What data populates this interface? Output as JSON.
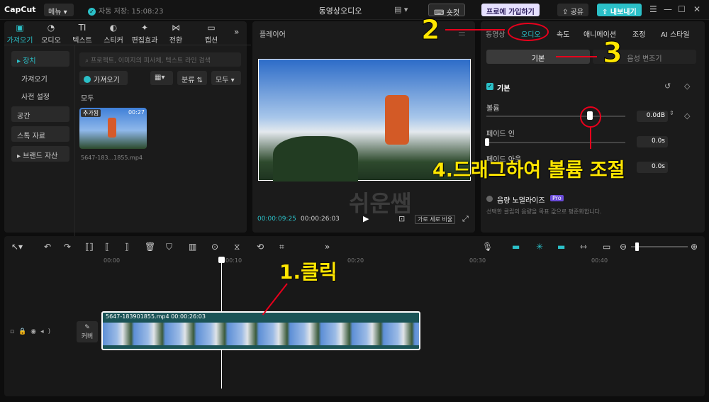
{
  "titlebar": {
    "logo": "CapCut",
    "menu_label": "메뉴 ▾",
    "autosave_text": "자동 저장: 15:08:23",
    "project_title": "동영상오디오",
    "shortcut_label": "숏컷",
    "pro_label": "프로에 가입하기",
    "share_label": "공유",
    "export_label": "내보내기"
  },
  "left_tabs": [
    {
      "icon": "media-icon",
      "label": "가져오기",
      "active": true
    },
    {
      "icon": "audio-icon",
      "label": "오디오"
    },
    {
      "icon": "text-icon",
      "label": "텍스트"
    },
    {
      "icon": "sticker-icon",
      "label": "스티커"
    },
    {
      "icon": "effects-icon",
      "label": "편집효과"
    },
    {
      "icon": "transition-icon",
      "label": "전환"
    },
    {
      "icon": "caption-icon",
      "label": "캡션"
    }
  ],
  "sidebar": [
    "▸ 장치",
    "가져오기",
    "사전 설정",
    "공간",
    "스톡 자료",
    "▸ 브랜드 자산"
  ],
  "media": {
    "search_placeholder": "프로젝트, 이미지의 피사체, 텍스트 라인 검색",
    "import_label": "가져오기",
    "sort_label": "분류 ⇅",
    "all_filter_label": "모두 ▾",
    "section_label": "모두",
    "thumb_badge": "추가됨",
    "thumb_duration": "00:27",
    "thumb_name": "5647-183...1855.mp4"
  },
  "player": {
    "title": "플레이어",
    "current_time": "00:00:09:25",
    "total_time": "00:00:26:03",
    "ratio_label": "가로 세로 비율",
    "watermark": "쉬운쌤"
  },
  "right_panel": {
    "tabs": [
      "동영상",
      "오디오",
      "속도",
      "애니메이션",
      "조정",
      "AI 스타일"
    ],
    "sub_tabs": [
      "기본",
      "음성 변조기"
    ],
    "section_title": "기본",
    "volume_label": "볼륨",
    "volume_value": "0.0dB",
    "fadein_label": "페이드 인",
    "fadein_value": "0.0s",
    "fadeout_label": "페이드 아웃",
    "fadeout_value": "0.0s",
    "normalize_label": "음량 노멀라이즈",
    "pro_badge": "Pro",
    "normalize_desc": "선택한 클립의 음량을 목표 값으로 평준화합니다."
  },
  "timeline": {
    "ruler": [
      "00:00",
      "00:10",
      "00:20",
      "00:30",
      "00:40"
    ],
    "cover_label": "커버",
    "clip_label": "5647-183901855.mp4   00:00:26:03"
  },
  "annotations": {
    "n1": "1.클릭",
    "n2": "2",
    "n3": "3",
    "n4": "4.드래그하여 볼륨 조절"
  },
  "colors": {
    "accent": "#2bc0c8",
    "annotation": "#ffe600",
    "marker": "#e8001c"
  }
}
